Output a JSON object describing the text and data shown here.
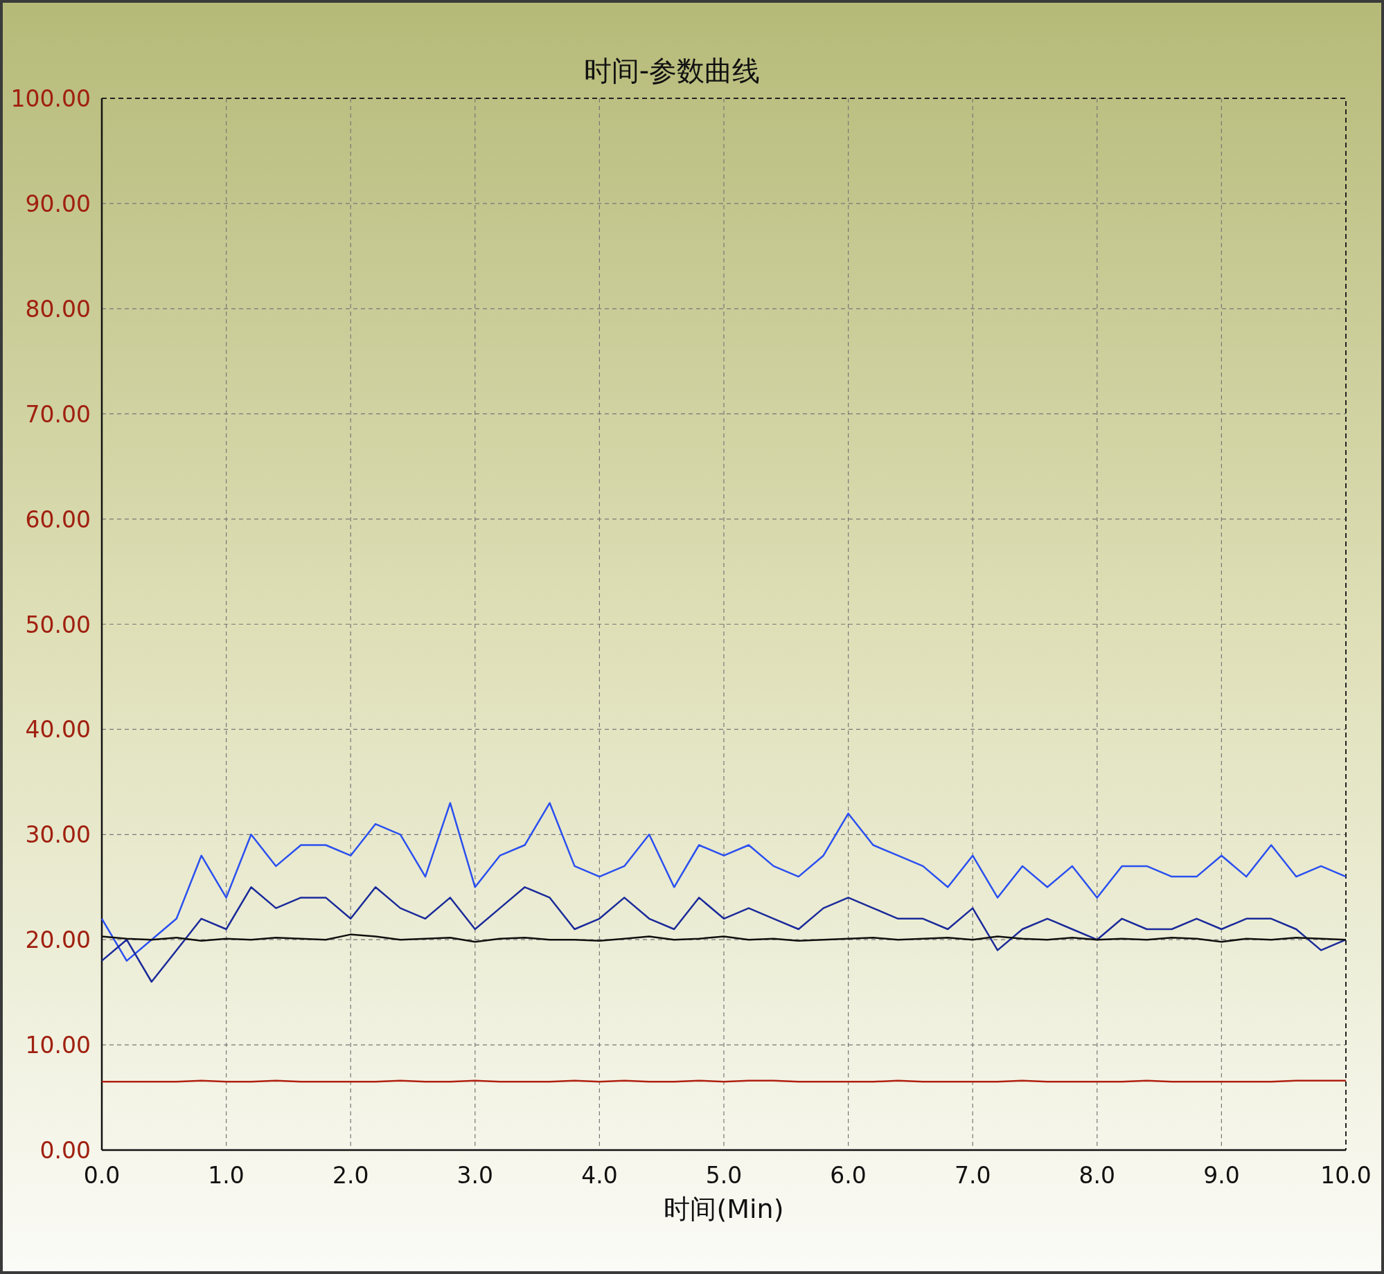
{
  "chart_data": {
    "type": "line",
    "grid": true,
    "title": "时间-参数曲线",
    "xlabel": "时间(Min)",
    "xlim": [
      0,
      10
    ],
    "ylim": [
      0,
      100
    ],
    "xticks": [
      {
        "value": 0,
        "label": "0.0"
      },
      {
        "value": 1,
        "label": "1.0"
      },
      {
        "value": 2,
        "label": "2.0"
      },
      {
        "value": 3,
        "label": "3.0"
      },
      {
        "value": 4,
        "label": "4.0"
      },
      {
        "value": 5,
        "label": "5.0"
      },
      {
        "value": 6,
        "label": "6.0"
      },
      {
        "value": 7,
        "label": "7.0"
      },
      {
        "value": 8,
        "label": "8.0"
      },
      {
        "value": 9,
        "label": "9.0"
      },
      {
        "value": 10,
        "label": "10.0"
      }
    ],
    "yticks": [
      {
        "value": 0,
        "label": "0.00"
      },
      {
        "value": 10,
        "label": "10.00"
      },
      {
        "value": 20,
        "label": "20.00"
      },
      {
        "value": 30,
        "label": "30.00"
      },
      {
        "value": 40,
        "label": "40.00"
      },
      {
        "value": 50,
        "label": "50.00"
      },
      {
        "value": 60,
        "label": "60.00"
      },
      {
        "value": 70,
        "label": "70.00"
      },
      {
        "value": 80,
        "label": "80.00"
      },
      {
        "value": 90,
        "label": "90.00"
      },
      {
        "value": 100,
        "label": "100.00"
      }
    ],
    "x": [
      0,
      0.2,
      0.4,
      0.6,
      0.8,
      1,
      1.2,
      1.4,
      1.6,
      1.8,
      2,
      2.2,
      2.4,
      2.6,
      2.8,
      3,
      3.2,
      3.4,
      3.6,
      3.8,
      4,
      4.2,
      4.4,
      4.6,
      4.8,
      5,
      5.2,
      5.4,
      5.6,
      5.8,
      6,
      6.2,
      6.4,
      6.6,
      6.8,
      7,
      7.2,
      7.4,
      7.6,
      7.8,
      8,
      8.2,
      8.4,
      8.6,
      8.8,
      9,
      9.2,
      9.4,
      9.6,
      9.8,
      10
    ],
    "series": [
      {
        "color": "#2a4ff0",
        "values": [
          22,
          18,
          20,
          22,
          28,
          24,
          30,
          27,
          29,
          29,
          28,
          31,
          30,
          26,
          33,
          25,
          28,
          29,
          33,
          27,
          26,
          27,
          30,
          25,
          29,
          28,
          29,
          27,
          26,
          28,
          32,
          29,
          28,
          27,
          25,
          28,
          24,
          27,
          25,
          27,
          24,
          27,
          27,
          26,
          26,
          28,
          26,
          29,
          26,
          27,
          26
        ]
      },
      {
        "color": "#1a2a9a",
        "values": [
          18,
          20,
          16,
          19,
          22,
          21,
          25,
          23,
          24,
          24,
          22,
          25,
          23,
          22,
          24,
          21,
          23,
          25,
          24,
          21,
          22,
          24,
          22,
          21,
          24,
          22,
          23,
          22,
          21,
          23,
          24,
          23,
          22,
          22,
          21,
          23,
          19,
          21,
          22,
          21,
          20,
          22,
          21,
          21,
          22,
          21,
          22,
          22,
          21,
          19,
          20
        ]
      },
      {
        "color": "#101010",
        "values": [
          20.3,
          20.1,
          20,
          20.2,
          19.9,
          20.1,
          20,
          20.2,
          20.1,
          20,
          20.5,
          20.3,
          20,
          20.1,
          20.2,
          19.8,
          20.1,
          20.2,
          20,
          20,
          19.9,
          20.1,
          20.3,
          20,
          20.1,
          20.3,
          20,
          20.1,
          19.9,
          20,
          20.1,
          20.2,
          20,
          20.1,
          20.2,
          20,
          20.3,
          20.1,
          20,
          20.2,
          20,
          20.1,
          20,
          20.2,
          20.1,
          19.8,
          20.1,
          20,
          20.2,
          20.1,
          20
        ]
      },
      {
        "color": "#b02010",
        "values": [
          6.5,
          6.5,
          6.5,
          6.5,
          6.6,
          6.5,
          6.5,
          6.6,
          6.5,
          6.5,
          6.5,
          6.5,
          6.6,
          6.5,
          6.5,
          6.6,
          6.5,
          6.5,
          6.5,
          6.6,
          6.5,
          6.6,
          6.5,
          6.5,
          6.6,
          6.5,
          6.6,
          6.6,
          6.5,
          6.5,
          6.5,
          6.5,
          6.6,
          6.5,
          6.5,
          6.5,
          6.5,
          6.6,
          6.5,
          6.5,
          6.5,
          6.5,
          6.6,
          6.5,
          6.5,
          6.5,
          6.5,
          6.5,
          6.6,
          6.6,
          6.6
        ]
      }
    ]
  }
}
